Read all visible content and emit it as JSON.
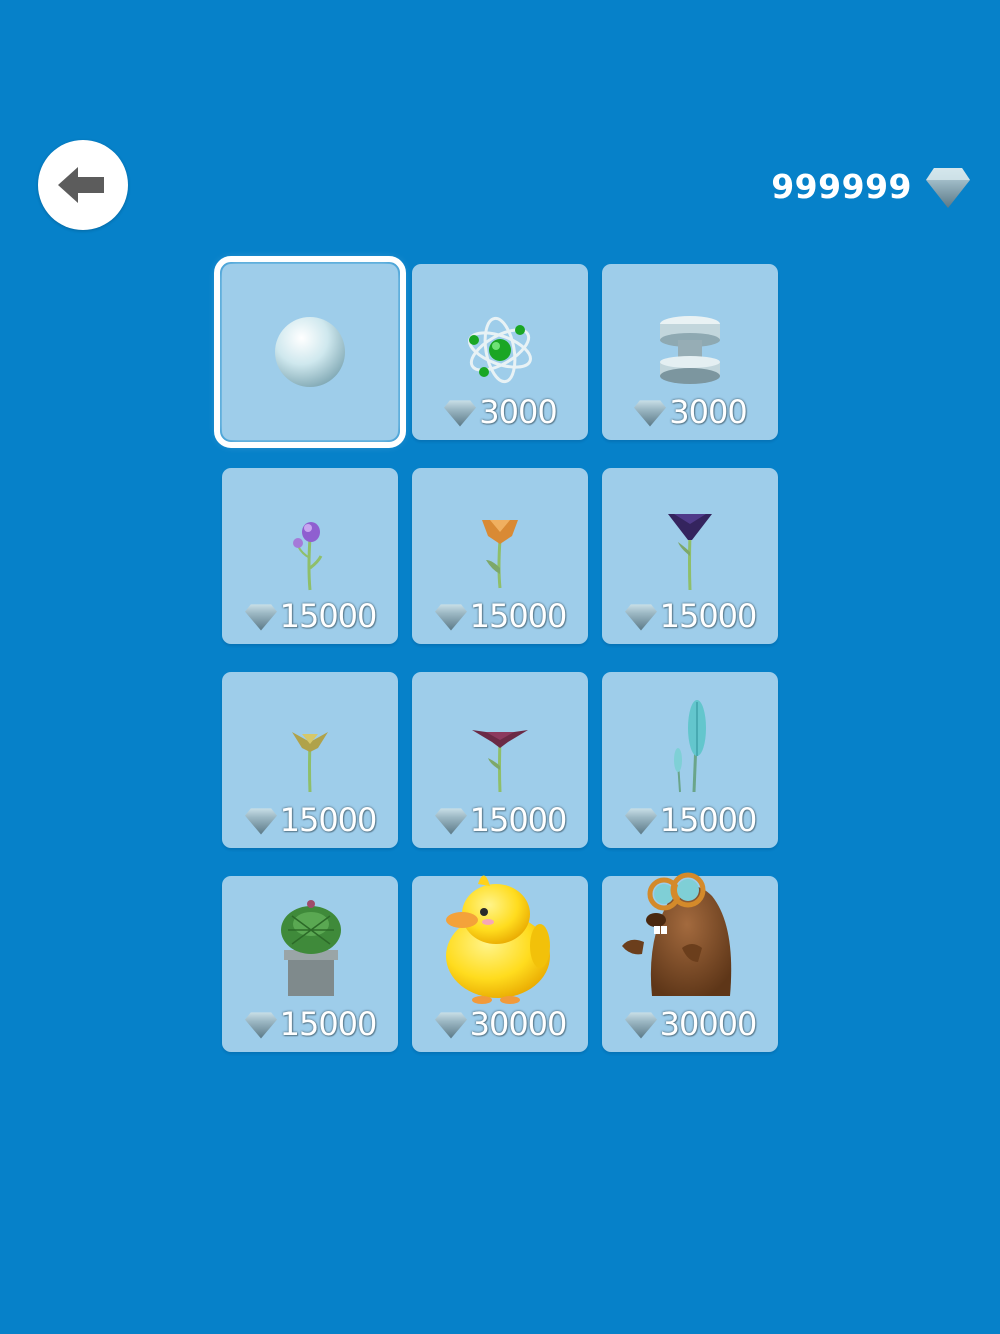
{
  "header": {
    "back_icon": "arrow-left-icon",
    "currency_value": "999999",
    "currency_icon": "diamond-icon"
  },
  "shop": {
    "items": [
      {
        "name": "sphere",
        "price": "",
        "selected": true
      },
      {
        "name": "atom",
        "price": "3000"
      },
      {
        "name": "spinning-top",
        "price": "3000"
      },
      {
        "name": "purple-bud-flower",
        "price": "15000"
      },
      {
        "name": "orange-flower",
        "price": "15000"
      },
      {
        "name": "indigo-cone-flower",
        "price": "15000"
      },
      {
        "name": "yellow-star-flower",
        "price": "15000"
      },
      {
        "name": "maroon-flower",
        "price": "15000"
      },
      {
        "name": "teal-feather-plant",
        "price": "15000"
      },
      {
        "name": "potted-cactus",
        "price": "15000"
      },
      {
        "name": "yellow-duck",
        "price": "30000"
      },
      {
        "name": "mole-with-goggles",
        "price": "30000"
      }
    ]
  },
  "colors": {
    "background": "#0681c9",
    "card": "#9ecdea",
    "diamond": "#7c9aa8"
  }
}
